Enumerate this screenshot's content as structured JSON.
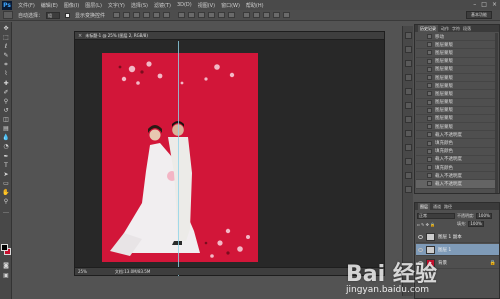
{
  "app": {
    "logo": "Ps"
  },
  "menu": [
    "文件(F)",
    "编辑(E)",
    "图像(I)",
    "图层(L)",
    "文字(Y)",
    "选择(S)",
    "滤镜(T)",
    "3D(D)",
    "视图(V)",
    "窗口(W)",
    "帮助(H)"
  ],
  "window_controls": [
    "–",
    "□",
    "×"
  ],
  "options_bar": {
    "auto_select_label": "自动选择：",
    "auto_select_value": "组",
    "show_transform_label": "显示变换控件",
    "workspace_label": "基本功能"
  },
  "document": {
    "title": "未标题-1 @ 25% (图层 2, RGB/8)",
    "zoom": "25%",
    "info": "文档:13.0M/83.5M"
  },
  "history_panel": {
    "tabs": [
      "历史记录",
      "动作",
      "字符",
      "段落"
    ],
    "items": [
      "移动",
      "图层蒙版",
      "图层蒙版",
      "图层蒙版",
      "图层蒙版",
      "图层蒙版",
      "图层蒙版",
      "图层蒙版",
      "图层蒙版",
      "图层蒙版",
      "图层蒙版",
      "图层蒙版",
      "载入不透明度",
      "填充颜色",
      "填充颜色",
      "载入不透明度",
      "填充颜色",
      "载入不透明度",
      "载入不透明度"
    ],
    "active_index": 18
  },
  "layers_panel": {
    "tabs": [
      "图层",
      "通道",
      "路径"
    ],
    "blend_mode": "正常",
    "opacity_label": "不透明度:",
    "opacity_value": "100%",
    "fill_label": "填充:",
    "fill_value": "100%",
    "layers": [
      {
        "name": "图层 1 副本",
        "active": false
      },
      {
        "name": "图层 1",
        "active": true
      },
      {
        "name": "背景",
        "active": false
      }
    ]
  },
  "watermark": {
    "text": "Bai 经验",
    "url": "jingyan.baidu.com"
  },
  "colors": {
    "canvas_red": "#d21639",
    "ui_bg": "#535353",
    "accent": "#3ea6ff"
  }
}
